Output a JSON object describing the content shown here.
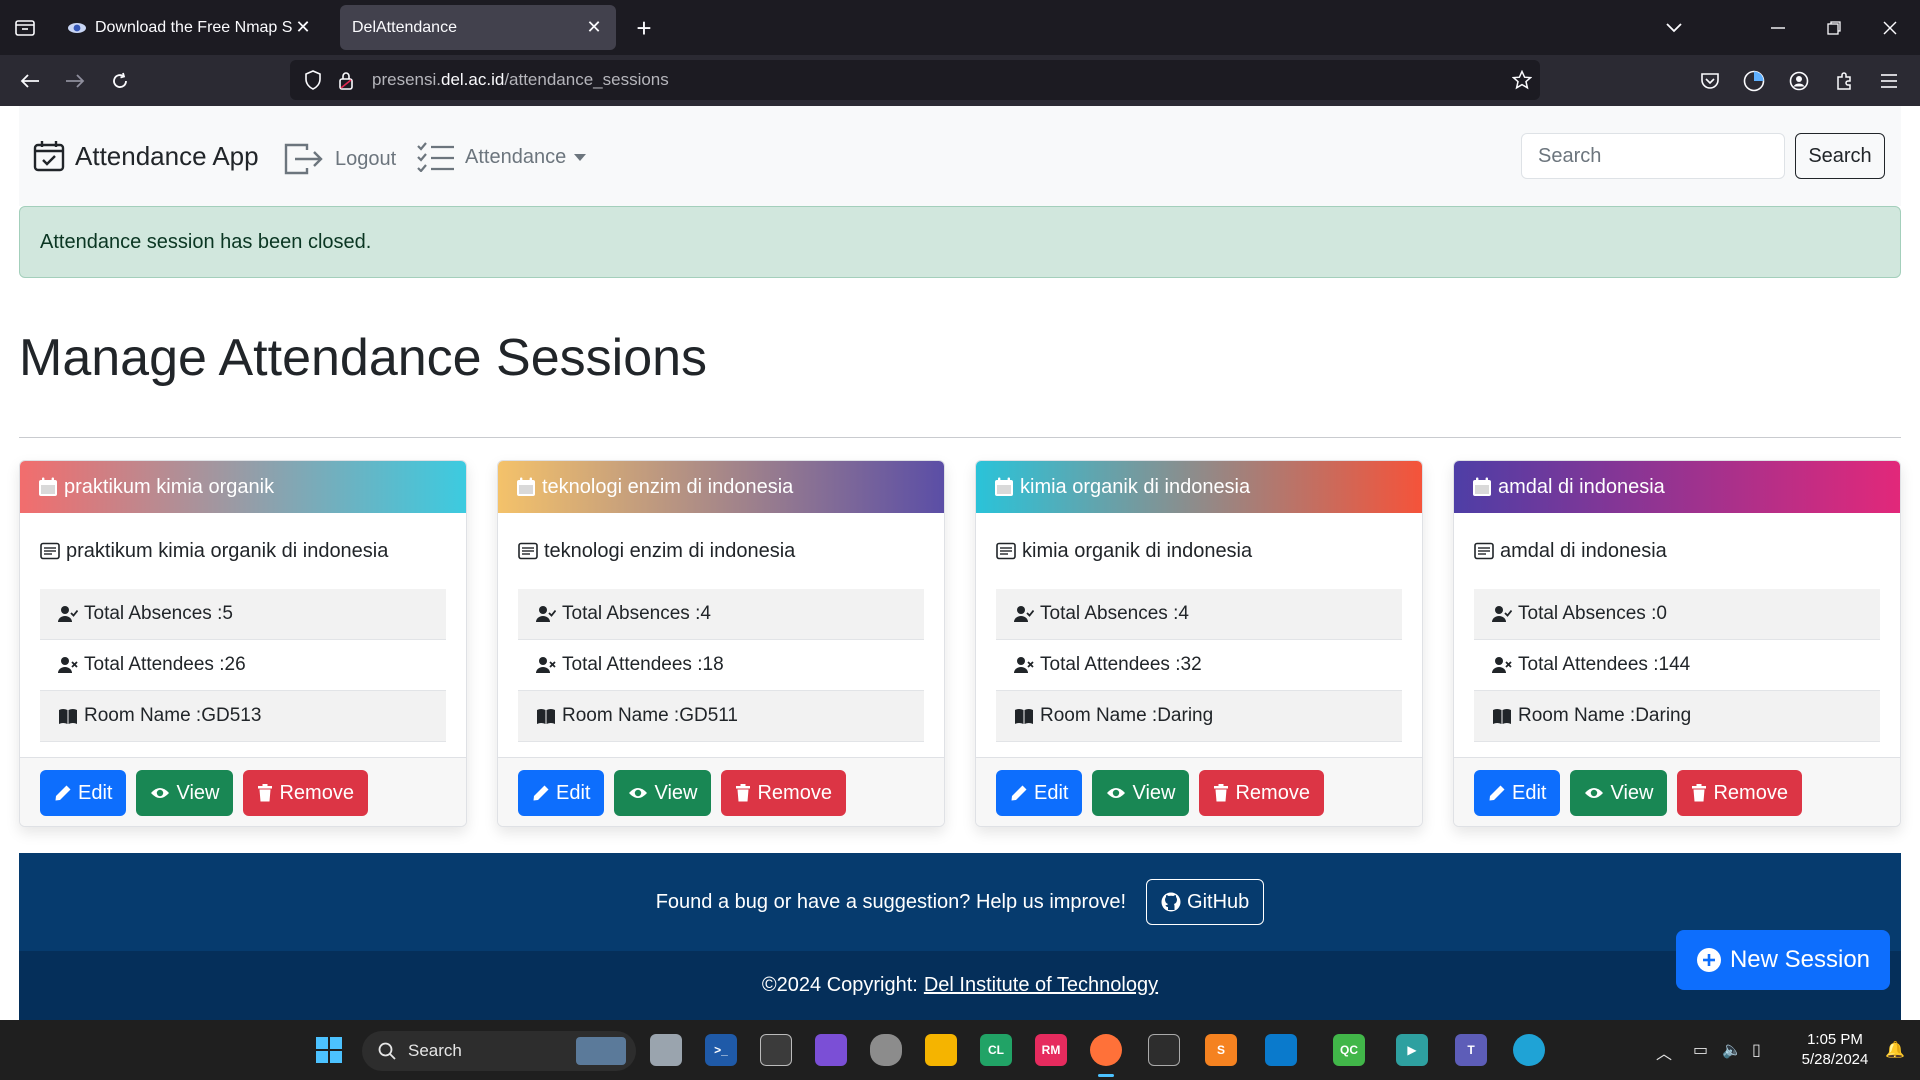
{
  "browser": {
    "tabs": [
      {
        "title": "Download the Free Nmap Security Scanner",
        "active": false
      },
      {
        "title": "DelAttendance",
        "active": true
      }
    ],
    "url_prefix": "presensi.",
    "url_domain": "del.ac.id",
    "url_path": "/attendance_sessions"
  },
  "navbar": {
    "brand": "Attendance App",
    "logout": "Logout",
    "attendance": "Attendance",
    "search_placeholder": "Search",
    "search_button": "Search"
  },
  "alert": {
    "message": "Attendance session has been closed."
  },
  "page": {
    "title": "Manage Attendance Sessions"
  },
  "labels": {
    "total_absences": "Total Absences : ",
    "total_attendees": "Total Attendees : ",
    "room_name": "Room Name : ",
    "edit": "Edit",
    "view": "View",
    "remove": "Remove"
  },
  "sessions": [
    {
      "title": "praktikum kimia organik",
      "description": "praktikum kimia organik di indonesia",
      "absences": "5",
      "attendees": "26",
      "room": "GD513",
      "gradient": [
        "#f26d6d",
        "#3ccbe0"
      ]
    },
    {
      "title": "teknologi enzim di indonesia",
      "description": "teknologi enzim di indonesia",
      "absences": "4",
      "attendees": "18",
      "room": "GD511",
      "gradient": [
        "#f4c26a",
        "#5b4ea6"
      ]
    },
    {
      "title": "kimia organik di indonesia",
      "description": "kimia organik di indonesia",
      "absences": "4",
      "attendees": "32",
      "room": "Daring",
      "gradient": [
        "#2ac3d9",
        "#f5533a"
      ]
    },
    {
      "title": "amdal di indonesia",
      "description": "amdal di indonesia",
      "absences": "0",
      "attendees": "144",
      "room": "Daring",
      "gradient": [
        "#4e3ea6",
        "#e2287a"
      ]
    }
  ],
  "footer": {
    "prompt": "Found a bug or have a suggestion? Help us improve!",
    "github": "GitHub",
    "copyright": "©2024 Copyright:",
    "institution": "Del Institute of Technology"
  },
  "fab": {
    "label": "New Session"
  },
  "taskbar": {
    "search": "Search",
    "time": "1:05 PM",
    "date": "5/28/2024"
  },
  "colors": {
    "primary": "#0d6efd",
    "success": "#198754",
    "danger": "#dc3545",
    "footer": "#063b6e",
    "alert_bg": "#d1e7dd"
  }
}
